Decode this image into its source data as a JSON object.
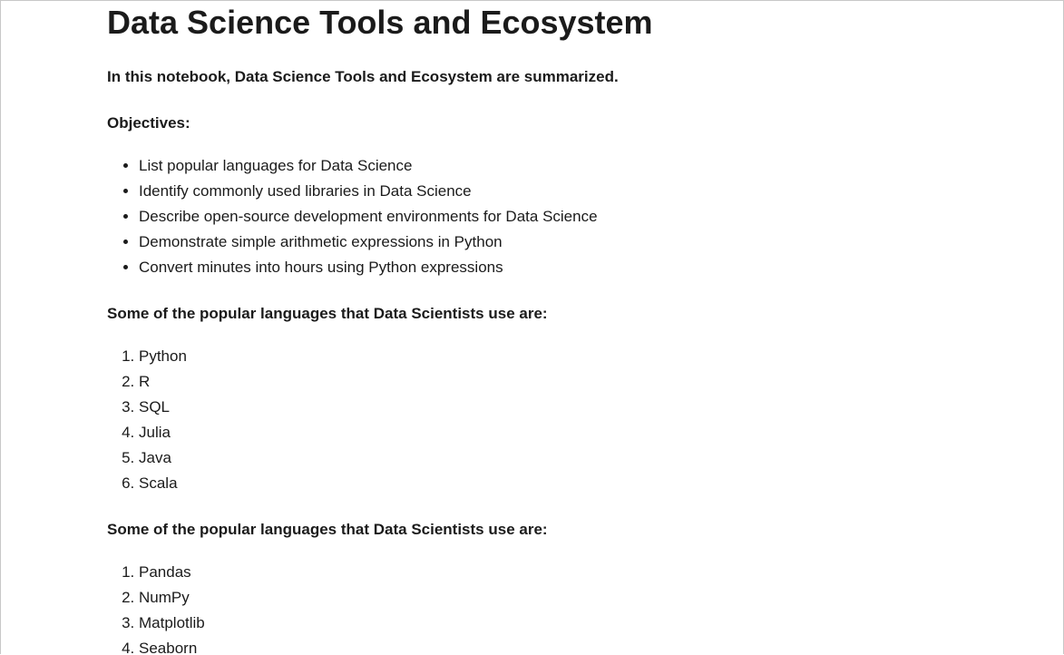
{
  "title": "Data Science Tools and Ecosystem",
  "intro": "In this notebook, Data Science Tools and Ecosystem are summarized.",
  "objectives": {
    "heading": "Objectives:",
    "items": [
      "List popular languages for Data Science",
      "Identify commonly used libraries in Data Science",
      "Describe open-source development environments for Data Science",
      "Demonstrate simple arithmetic expressions in Python",
      "Convert minutes into hours using Python expressions"
    ]
  },
  "languages": {
    "heading": "Some of the popular languages that Data Scientists use are:",
    "items": [
      "Python",
      "R",
      "SQL",
      "Julia",
      "Java",
      "Scala"
    ]
  },
  "libraries": {
    "heading": "Some of the popular languages that Data Scientists use are:",
    "items": [
      "Pandas",
      "NumPy",
      "Matplotlib",
      "Seaborn"
    ]
  }
}
